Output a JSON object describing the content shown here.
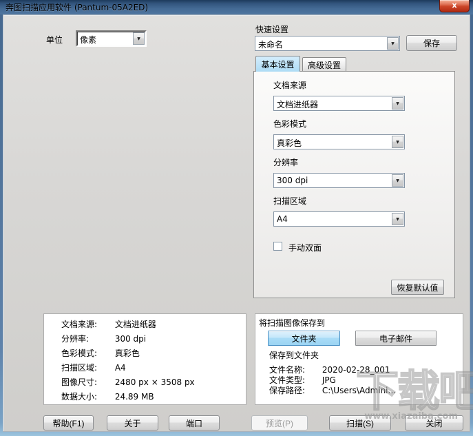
{
  "window": {
    "title": "奔图扫描应用软件 (Pantum-05A2ED)",
    "close_glyph": "x"
  },
  "icons": {
    "dropdown_arrow": "▼"
  },
  "colors": {
    "titlebar_blue": "#44618a",
    "close_red": "#c23b22",
    "active_tab_blue": "#aedcf5",
    "folder_button_blue": "#b5e0f8",
    "client_gray": "#d6d5d3"
  },
  "toolbar": {
    "unit_label": "单位",
    "unit_value": "像素",
    "quick_settings_label": "快速设置",
    "quick_settings_value": "未命名",
    "save_button": "保存"
  },
  "tabs": {
    "basic": "基本设置",
    "advanced": "高级设置"
  },
  "basic_panel": {
    "fields": [
      {
        "label": "文档来源",
        "value": "文档进纸器"
      },
      {
        "label": "色彩模式",
        "value": "真彩色"
      },
      {
        "label": "分辨率",
        "value": "300 dpi"
      },
      {
        "label": "扫描区域",
        "value": "A4"
      }
    ],
    "duplex_checkbox_label": "手动双面",
    "restore_defaults_button": "恢复默认值"
  },
  "info_panel": {
    "rows": [
      {
        "label": "文档来源:",
        "value": "文档进纸器"
      },
      {
        "label": "分辨率:",
        "value": "300 dpi"
      },
      {
        "label": "色彩模式:",
        "value": "真彩色"
      },
      {
        "label": "扫描区域:",
        "value": "A4"
      },
      {
        "label": "图像尺寸:",
        "value": "2480 px × 3508 px"
      },
      {
        "label": "数据大小:",
        "value": "24.89 MB"
      }
    ]
  },
  "save_panel": {
    "title": "将扫描图像保存到",
    "folder_button": "文件夹",
    "email_button": "电子邮件",
    "subtitle": "保存到文件夹",
    "rows": [
      {
        "label": "文件名称:",
        "value": "2020-02-28_001"
      },
      {
        "label": "文件类型:",
        "value": "JPG"
      },
      {
        "label": "保存路径:",
        "value": "C:\\Users\\Admini..."
      }
    ]
  },
  "footer": {
    "help_button": "帮助(F1)",
    "about_button": "关于",
    "port_button": "端口",
    "preview_button": "预览(P)",
    "scan_button": "扫描(S)",
    "close_button": "关闭"
  },
  "watermark": {
    "text": "下载吧",
    "url": "www.xiazaiba.com"
  }
}
